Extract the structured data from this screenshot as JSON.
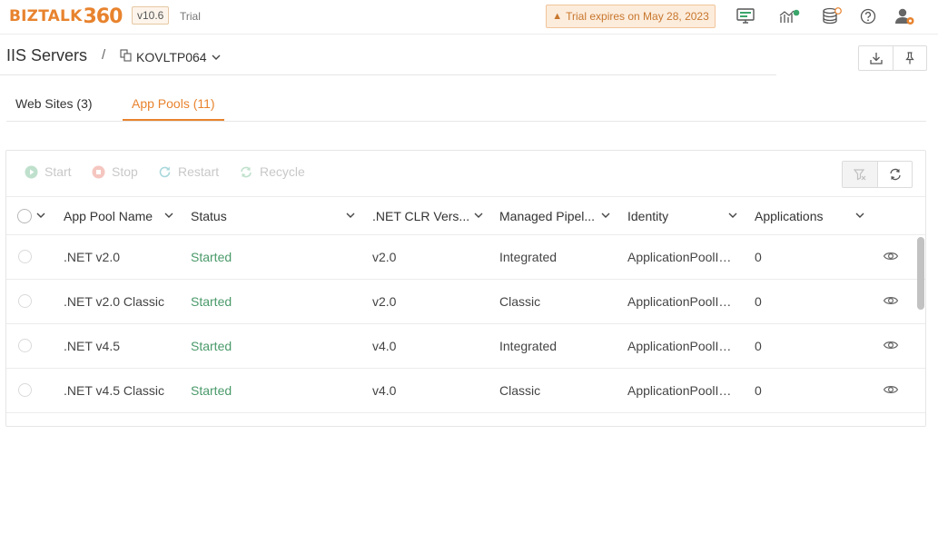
{
  "brand": {
    "logo_text": "BIZTALK",
    "logo_number": "360",
    "version": "v10.6",
    "edition": "Trial"
  },
  "trial_banner": {
    "text": "Trial expires on May 28, 2023"
  },
  "top_icons": [
    "monitor-icon",
    "analytics-icon",
    "database-icon",
    "help-icon",
    "user-icon"
  ],
  "breadcrumb": {
    "title": "IIS Servers",
    "separator": "/",
    "server": "KOVLTP064"
  },
  "tabs": [
    {
      "label": "Web Sites (3)",
      "active": false
    },
    {
      "label": "App Pools (11)",
      "active": true
    }
  ],
  "toolbar": {
    "start": "Start",
    "stop": "Stop",
    "restart": "Restart",
    "recycle": "Recycle"
  },
  "grid": {
    "columns": [
      "App Pool Name",
      "Status",
      ".NET CLR Vers...",
      "Managed Pipel...",
      "Identity",
      "Applications"
    ],
    "rows": [
      {
        "name": ".NET v2.0",
        "status": "Started",
        "clr": "v2.0",
        "pipeline": "Integrated",
        "identity": "ApplicationPoolIdentity",
        "applications": "0"
      },
      {
        "name": ".NET v2.0 Classic",
        "status": "Started",
        "clr": "v2.0",
        "pipeline": "Classic",
        "identity": "ApplicationPoolIdentity",
        "applications": "0"
      },
      {
        "name": ".NET v4.5",
        "status": "Started",
        "clr": "v4.0",
        "pipeline": "Integrated",
        "identity": "ApplicationPoolIdentity",
        "applications": "0"
      },
      {
        "name": ".NET v4.5 Classic",
        "status": "Started",
        "clr": "v4.0",
        "pipeline": "Classic",
        "identity": "ApplicationPoolIdentity",
        "applications": "0"
      }
    ]
  },
  "colors": {
    "accent": "#e8832e",
    "status_started": "#4a9a6a",
    "banner_bg": "#fcecdc"
  }
}
